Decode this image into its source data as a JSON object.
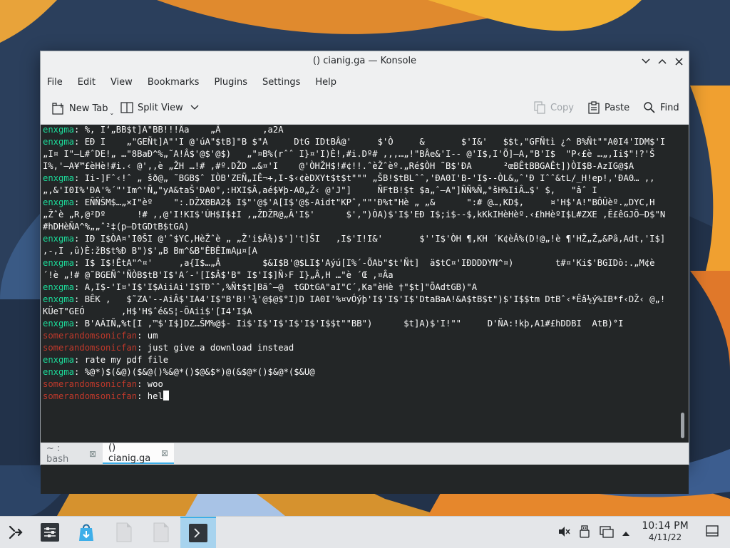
{
  "window": {
    "title": "() cianig.ga — Konsole"
  },
  "menu": [
    "File",
    "Edit",
    "View",
    "Bookmarks",
    "Plugins",
    "Settings",
    "Help"
  ],
  "toolbar": {
    "new_tab": "New Tab",
    "split_view": "Split View",
    "copy": "Copy",
    "paste": "Paste",
    "find": "Find"
  },
  "terminal": {
    "colors": {
      "own_nick": "#1cdc9a",
      "other_nick": "#c0392b",
      "background": "#232627"
    },
    "lines": [
      {
        "nick": "enxgma",
        "color": "green",
        "text": "%, I‘„BB$t]A\"BB!!!Âa    „Â        ,a2A"
      },
      {
        "nick": "enxgma",
        "color": "green",
        "text": "EÐ I    „\"GEÑt]A\"'I @'úA\"$tB]\"B $\"A     DtG IDtBÂ@'     $'Ò     &       $'I&'   $$t,\"GFÑtì ¿^ B%Ñt\"\"A0I4'IDM$'I„I¤ I\"—L#ˆDE!„ …\"8BaÐ^%„˜A!Â$'@$'@$)   „\"¤B%(rˆˆ I}¤'I)È!,#i.Dº# ,,,…„!\"BÂe&'I-- @'I$,I'Õ]—A,\"B'I$  \"P‹£è …„,Ii$\"!?'ŠI%,'—A¥™£èHè!#i.‹ @',,è „ŽH …!# ,#º.DŽD …&¤'I    @'ÒHŽH$!#¢!!.ˆèŽˆèº.„Ré$ÒH ˜B$'ÐA      ²œBÊtBBGAÊt])ÒI$B-AzIG@$A"
      },
      {
        "nick": "enxgma",
        "color": "green",
        "text": "Ii-]Fˆ‹!ˆ „ šð@„ ˜BGB$ˆ IÒB'ZEÑ„IÊ¬+,I-$‹¢èDXYt$t$t\"\"\" „ŠB!$tBLˆˆ,'ÐA0I'B-'I$--ÒL&„ˆ'Ð Iˆˆ&tL/_H!ep!,'ÐA0… ,, „,&'I0I%'ÐA'%´\"'Im^'Ñ„\"yA&taŠ'ÐA0°,:HXI$Â,aé$¥þ-A0„Ž‹ @'J\"]     ÑFtB!$t $a„ˆ—A\"]ÑÑ%Ñ„°šH%IiÂ…$' $,   \"âˆ I"
      },
      {
        "nick": "enxgma",
        "color": "green",
        "text": "EÑÑŠM$…„×I\"èº    \":.DŽXBBA2$ I$\"'@$'A[I$'@$-Aidt\"KPˆ,\"\"'Ð%t\"Hè „ „&      \":# @…,KD$,     ¤'H$'A!\"BÔÛèº.„DYC,H „Žˆè „R,@²Dº      !# ,,@'I!KI$'ÚH$I$‡I ,„ŽDŽR@„Â'I$'      $',\")ÒA)$'I$'EÐ I$;i$--$,kKkIHèHèº.‹£hHèºI$L#ZXE ,Ê£êGJÕ—D$\"N#hDHèÑA^%„„ˆ²‡(p—DtGDtB$tGA)"
      },
      {
        "nick": "enxgma",
        "color": "green",
        "text": "IÐ I$ÒA¤'I0ŠI @'ˆ$YC,HèŽˆè „ „Ž'i$Â¾)$']'t]ŠI   ,I$'I!I&'       $''I$'ÒH ¶,KH ´K¢èÂ%(D!@„!è ¶'HŽ„Ž„&Pâ,Adt,'I$]      ‚-,I ,û)È:žB$t%Ð B\")$'„B Bm^&B\"ÊBÊImAµ¤[A"
      },
      {
        "nick": "enxgma",
        "color": "green",
        "text": "I$ I$!ÊtA\"^¤'     ,a{I$…„Â        $&I$B'@$LI$'Aýú[I%´-ÕAb\"$t'Ñt]  ä$tC¤'IÐDDDYN^¤)        t#¤'Ki$'BGIDò:.„M¢è ´!è „!# @˜BGEÑˆ'ÑÒB$tB'I$'A´-'[I$Â$'B\" I$'I$]Ñ›F I}„Â,H …\"è ´Œ ,¤Âa"
      },
      {
        "nick": "enxgma",
        "color": "green",
        "text": "A,I$-'I¤'I$'I$AiiAi'I$TÐˆˆ,%Ñt$t]Bäˆ—@  tGDtGA\"aI\"C´,Ka\"èHè †\"$t]\"ÕAdtGB)\"A"
      },
      {
        "nick": "enxgma",
        "color": "green",
        "text": "BÊK ,   $˜ZA'--AiÂ$'IA4'I$\"B'B!'¾'@$@$°I)D IA0I'%¤vÓýþ'I$'I$'I$'DtaBaA!&A$tB$t\")$'I$$tm DtBˆ‹*Êâ½ý%IB*f‹DŽ‹ @„!KÜeT\"GEÓ       ,H$'H$ˆé&S¦-ÕAii$'[I4'I$A"
      },
      {
        "nick": "enxgma",
        "color": "green",
        "text": "B'AÁIÑ„%t[I ,™$'I$]DZ…ŠM%@$- Ii$'I$'I$'I$'I$'I$$t\"\"BB\")      $t]A)$'I!\"\"     D'ÑA:!kþ,A1#£hDDBI  AtB)°I"
      },
      {
        "nick": "somerandomsonicfan",
        "color": "red",
        "text": "um"
      },
      {
        "nick": "somerandomsonicfan",
        "color": "red",
        "text": "just give a download instead"
      },
      {
        "nick": "enxgma",
        "color": "green",
        "text": "rate my pdf file"
      },
      {
        "nick": "enxgma",
        "color": "green",
        "text": "%@*)$(&@)($&@()%&@*()$@&$*)@(&$@*()$&@*($&U@"
      },
      {
        "nick": "somerandomsonicfan",
        "color": "red",
        "text": "woo"
      },
      {
        "nick": "somerandomsonicfan",
        "color": "red",
        "text": "hel",
        "cursor": true
      }
    ]
  },
  "tabs": [
    {
      "label": "~ : bash",
      "active": false
    },
    {
      "label": "() cianig.ga",
      "active": true
    }
  ],
  "taskbar": {
    "icons": [
      "kde-launcher-icon",
      "system-settings-icon",
      "discover-icon",
      "file-icon",
      "file-icon",
      "konsole-icon"
    ],
    "clock_time": "10:14 PM",
    "clock_date": "4/11/22"
  }
}
